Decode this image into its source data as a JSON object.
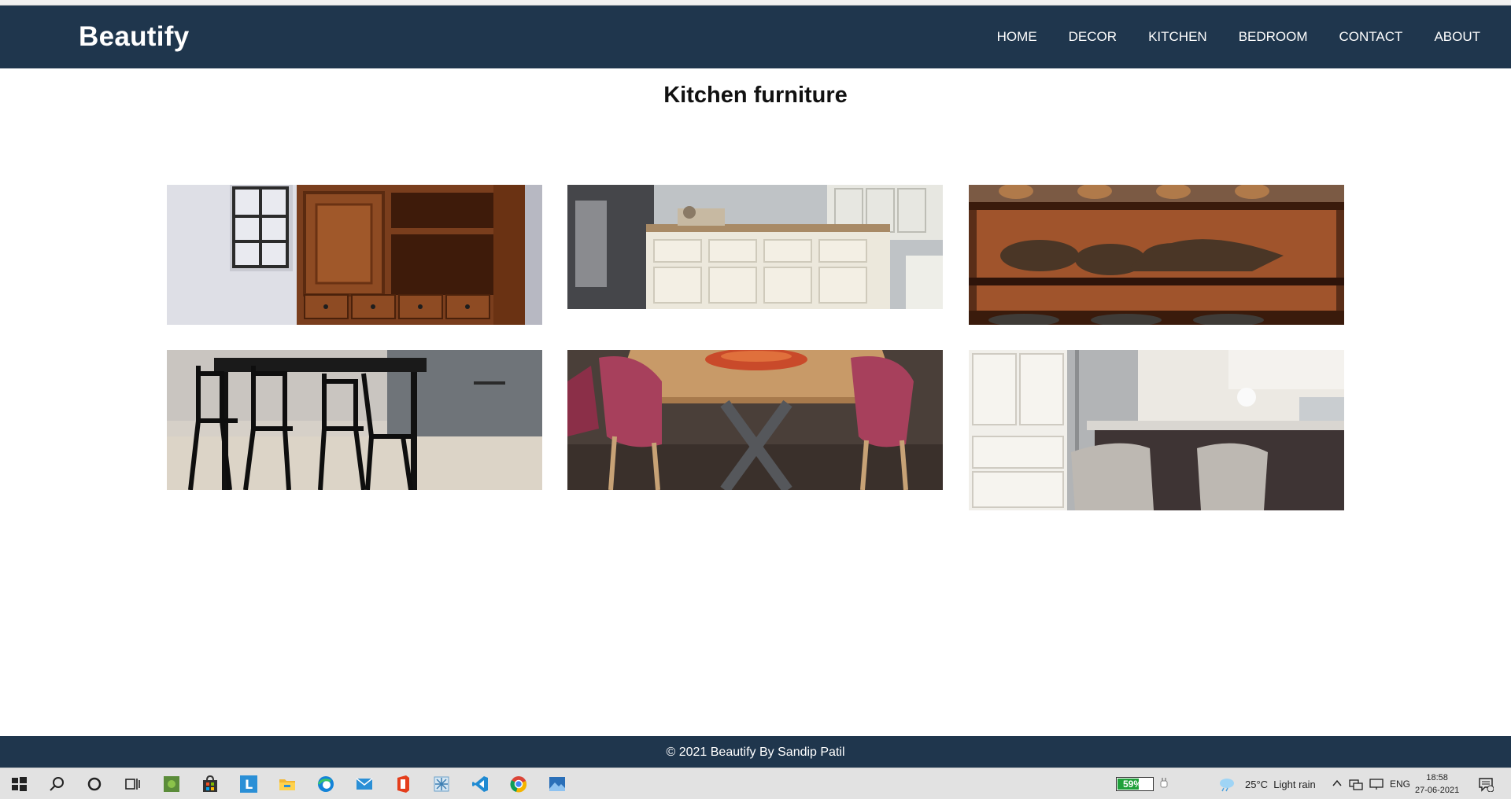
{
  "site": {
    "brand": "Beautify",
    "nav": [
      "HOME",
      "DECOR",
      "KITCHEN",
      "BEDROOM",
      "CONTACT",
      "ABOUT"
    ]
  },
  "page": {
    "heading": "Kitchen furniture"
  },
  "footer": {
    "text": "© 2021 Beautify By Sandip Patil"
  },
  "taskbar": {
    "apps": [
      "windows-start-icon",
      "search-icon",
      "cortana-icon",
      "task-view-icon",
      "app-icon",
      "store-icon",
      "app-l-icon",
      "file-explorer-icon",
      "edge-icon",
      "mail-icon",
      "office-icon",
      "snip-icon",
      "vscode-icon",
      "chrome-icon",
      "photos-icon"
    ],
    "battery": "59%",
    "battery_level": 0.59,
    "weather": "25°C  Light rain",
    "language": "ENG",
    "time": "18:58",
    "date": "27-06-2021"
  },
  "colors": {
    "navbar": "#1f364d",
    "footer": "#1f364d",
    "battery": "#1fa03a"
  }
}
